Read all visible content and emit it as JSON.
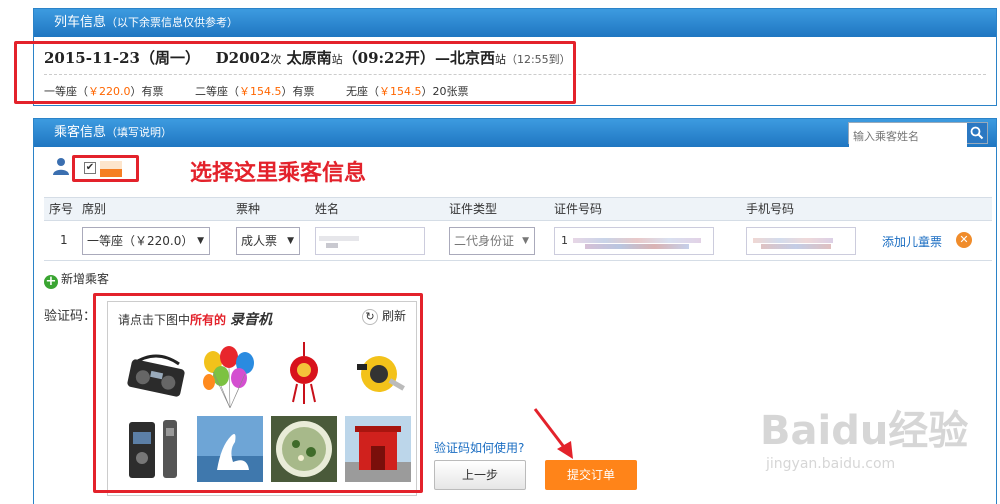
{
  "train_panel": {
    "title": "列车信息",
    "subtitle": "（以下余票信息仅供参考）",
    "date": "2015-11-23（周一）",
    "train_no": "D2002",
    "train_unit": "次",
    "from": "太原南",
    "from_unit": "站",
    "depart": "（09:22开）",
    "dash": "—",
    "to": "北京西",
    "to_unit": "站",
    "arrive": "（12:55到）",
    "seats": [
      {
        "name": "一等座（",
        "price": "￥220.0",
        "status": "）有票"
      },
      {
        "name": "二等座（",
        "price": "￥154.5",
        "status": "）有票"
      },
      {
        "name": "无座（",
        "price": "￥154.5",
        "status": "）20张票"
      }
    ]
  },
  "passenger_panel": {
    "title": "乘客信息",
    "subtitle": "（填写说明）",
    "search_placeholder": "输入乘客姓名",
    "annotation": "选择这里乘客信息",
    "checkbox_mark": "✔",
    "table_headers": [
      "序号",
      "席别",
      "票种",
      "姓名",
      "证件类型",
      "证件号码",
      "手机号码"
    ],
    "row": {
      "index": "1",
      "seat": "一等座（￥220.0）",
      "ticket_type": "成人票",
      "id_type": "二代身份证",
      "id_prefix": "1",
      "add_child": "添加儿童票",
      "delete_mark": "✕"
    },
    "add_passenger": "新增乘客",
    "captcha_label": "验证码：",
    "captcha": {
      "prompt": "请点击下图中",
      "prompt_highlight": "所有的",
      "target_word": "录音机",
      "refresh_label": "刷新",
      "refresh_mark": "↻"
    },
    "captcha_help": "验证码如何使用?",
    "prev_button": "上一步",
    "submit_button": "提交订单"
  },
  "watermark": {
    "main": "Baidu经验",
    "sub": "jingyan.baidu.com"
  },
  "colors": {
    "panel_blue": "#2b83c8",
    "highlight_red": "#e3222b",
    "price_orange": "#ff6600",
    "submit_orange": "#ff8419",
    "link_blue": "#1a6dc2"
  }
}
